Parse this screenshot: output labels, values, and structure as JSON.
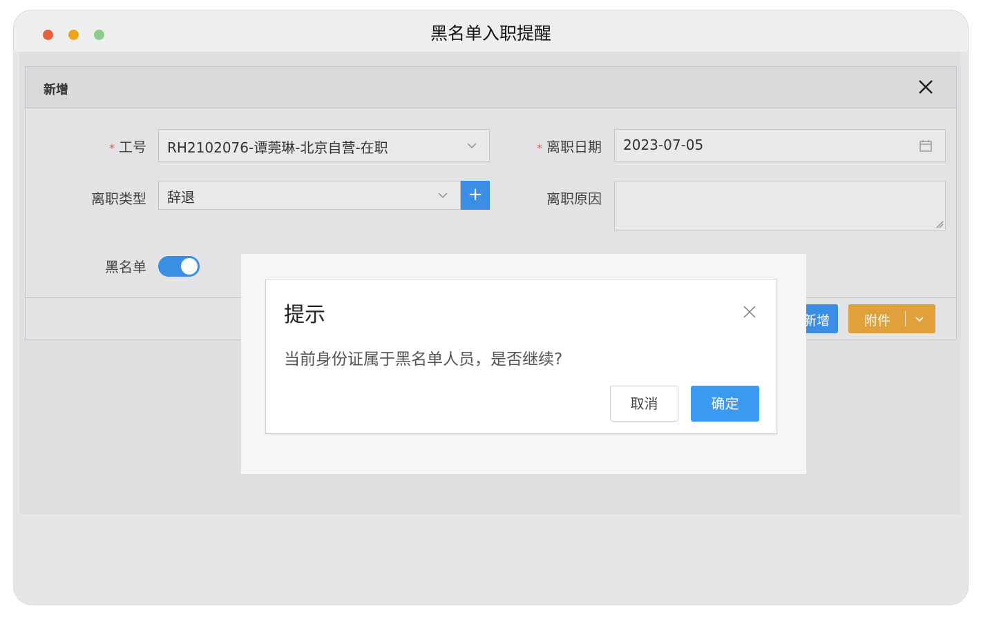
{
  "window": {
    "title": "黑名单入职提醒"
  },
  "form": {
    "header_title": "新增",
    "required_mark": "*",
    "employee_id": {
      "label": "工号",
      "value": "RH2102076-谭莞琳-北京自营-在职"
    },
    "resign_date": {
      "label": "离职日期",
      "value": "2023-07-05"
    },
    "resign_type": {
      "label": "离职类型",
      "value": "辞退",
      "add_label": "+"
    },
    "resign_reason": {
      "label": "离职原因",
      "value": ""
    },
    "blacklist": {
      "label": "黑名单",
      "enabled": true
    }
  },
  "footer": {
    "add_partial": "新增",
    "attach_label": "附件"
  },
  "dialog": {
    "title": "提示",
    "message": "当前身份证属于黑名单人员，是否继续?",
    "cancel_label": "取消",
    "confirm_label": "确定"
  },
  "colors": {
    "primary": "#3b99f2",
    "attach": "#e0a03a",
    "required": "#e65a4a"
  }
}
